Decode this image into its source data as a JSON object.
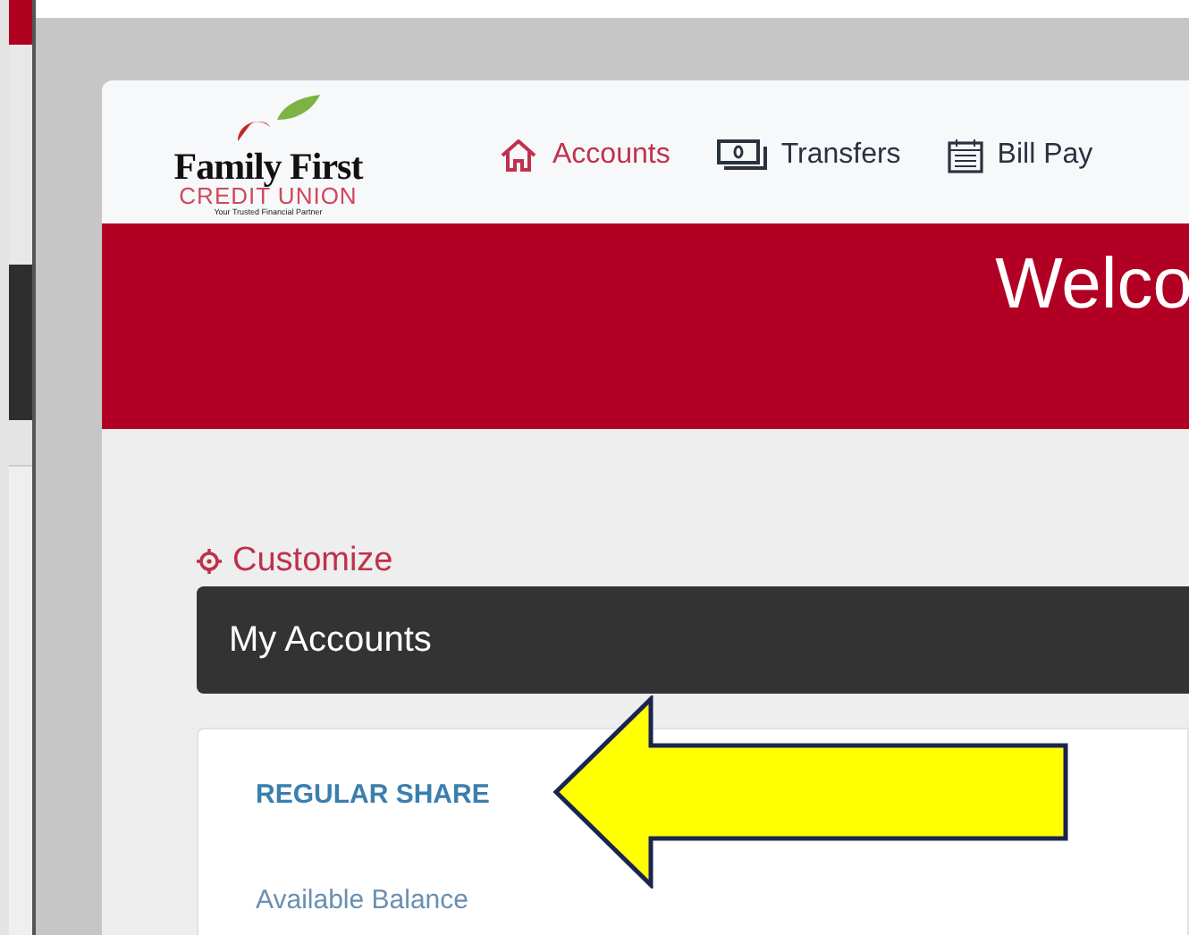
{
  "logo": {
    "name": "Family First",
    "subtitle": "CREDIT UNION",
    "tagline": "Your Trusted Financial Partner"
  },
  "nav": [
    {
      "label": "Accounts",
      "kind": "home",
      "selected": true
    },
    {
      "label": "Transfers",
      "kind": "money",
      "selected": false
    },
    {
      "label": "Bill Pay",
      "kind": "calendar",
      "selected": false
    }
  ],
  "banner": {
    "title": "Welco"
  },
  "customize": "Customize",
  "section": {
    "title": "My Accounts"
  },
  "account": {
    "name": "REGULAR SHARE",
    "balance_label": "Available Balance"
  }
}
